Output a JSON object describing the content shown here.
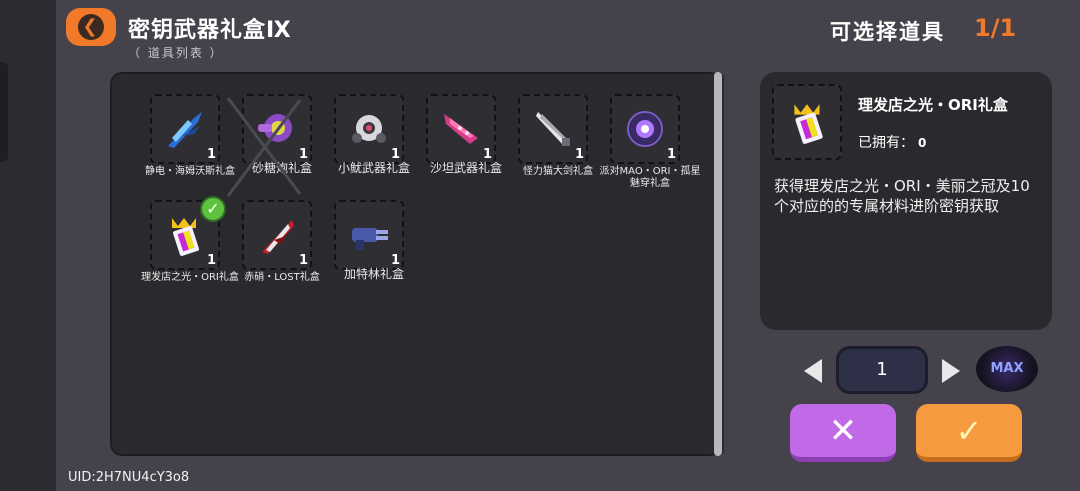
{
  "header": {
    "title": "密钥武器礼盒Ⅸ",
    "subtitle": "（ 道具列表 ）",
    "select_label": "可选择道具",
    "select_count": "1/1"
  },
  "items": [
    {
      "name": "静电・海姆沃斯礼盒",
      "qty": "1",
      "icon": "blue-blade-icon"
    },
    {
      "name": "砂糖炮礼盒",
      "qty": "1",
      "icon": "purple-cannon-icon"
    },
    {
      "name": "小鱿武器礼盒",
      "qty": "1",
      "icon": "squid-weapon-icon"
    },
    {
      "name": "沙坦武器礼盒",
      "qty": "1",
      "icon": "pink-claw-icon"
    },
    {
      "name": "怪力猫大剑礼盒",
      "qty": "1",
      "icon": "silver-sword-icon"
    },
    {
      "name": "派对MAO・ORI・孤星魅穿礼盒",
      "qty": "1",
      "icon": "star-orb-icon"
    },
    {
      "name": "理发店之光・ORI礼盒",
      "qty": "1",
      "icon": "crown-comb-icon",
      "selected": true
    },
    {
      "name": "赤硝・LOST礼盒",
      "qty": "1",
      "icon": "red-blade-icon"
    },
    {
      "name": "加特林礼盒",
      "qty": "1",
      "icon": "gatling-icon"
    }
  ],
  "detail": {
    "name": "理发店之光・ORI礼盒",
    "owned_label": "已拥有：",
    "owned_value": "0",
    "description": "获得理发店之光・ORI・美丽之冠及10个对应的的专属材料进阶密钥获取"
  },
  "quantity": {
    "value": "1",
    "max_label": "MAX"
  },
  "buttons": {
    "cancel": "✕",
    "confirm": "✓"
  },
  "uid": "UID:2H7NU4cY3o8",
  "colors": {
    "accent_orange": "#f07a2a",
    "cancel_purple": "#c16ae8",
    "confirm_orange": "#f59a3e",
    "panel": "#2a292d",
    "background": "#45424c"
  }
}
